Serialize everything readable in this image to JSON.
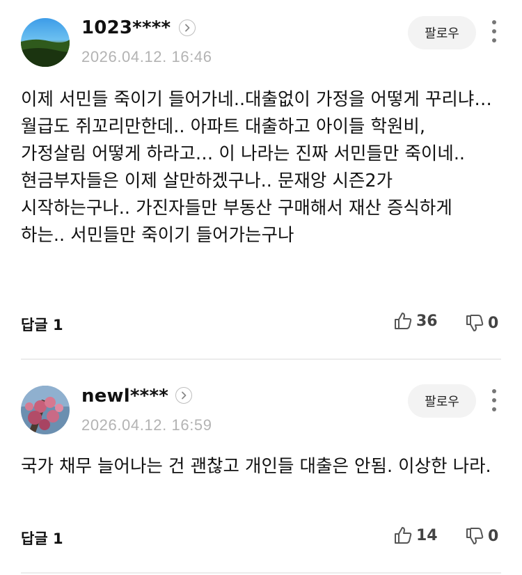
{
  "comments": [
    {
      "username": "1023****",
      "date": "2026.04.12. 16:46",
      "follow_label": "팔로우",
      "text": "이제 서민들 죽이기 들어가네..대출없이 가정을 어떻게 꾸리냐… 월급도 쥐꼬리만한데.. 아파트 대출하고 아이들 학원비, 가정살림 어떻게 하라고… 이 나라는 진짜 서민들만 죽이네.. 현금부자들은 이제 살만하겠구나.. 문재앙 시즌2가 시작하는구나.. 가진자들만 부동산 구매해서 재산 증식하게 하는.. 서민들만 죽이기 들어가는구나",
      "reply_label": "답글 1",
      "likes": "36",
      "dislikes": "0"
    },
    {
      "username": "newl****",
      "date": "2026.04.12. 16:59",
      "follow_label": "팔로우",
      "text": "국가 채무 늘어나는 건 괜찮고 개인들 대출은 안됨. 이상한 나라.",
      "reply_label": "답글 1",
      "likes": "14",
      "dislikes": "0"
    }
  ],
  "icons": {
    "profile_link": "chevron-right-icon",
    "more": "more-vertical-icon",
    "like": "thumbs-up-icon",
    "dislike": "thumbs-down-icon"
  }
}
